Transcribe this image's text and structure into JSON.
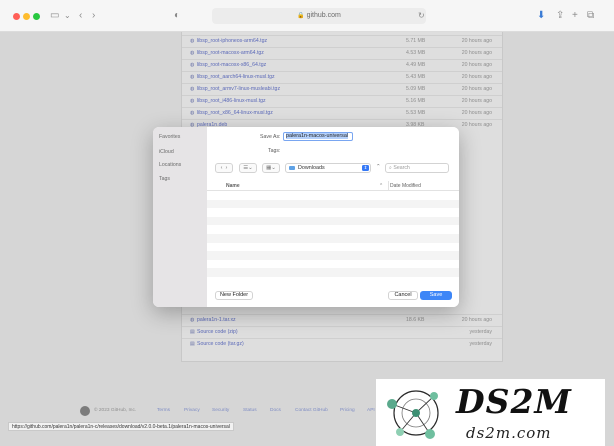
{
  "browser": {
    "url": "github.com",
    "lock_icon": "lock-icon"
  },
  "assets": [
    {
      "name": "libsp_root-iphoneos-arm64.tgz",
      "size": "5.71 MB",
      "date": "20 hours ago"
    },
    {
      "name": "libsp_root-macosx-arm64.tgz",
      "size": "4.53 MB",
      "date": "20 hours ago"
    },
    {
      "name": "libsp_root-macosx-x86_64.tgz",
      "size": "4.49 MB",
      "date": "20 hours ago"
    },
    {
      "name": "libsp_root_aarch64-linux-musl.tgz",
      "size": "5.43 MB",
      "date": "20 hours ago"
    },
    {
      "name": "libsp_root_armv7-linux-musleabi.tgz",
      "size": "5.09 MB",
      "date": "20 hours ago"
    },
    {
      "name": "libsp_root_i486-linux-musl.tgz",
      "size": "5.16 MB",
      "date": "20 hours ago"
    },
    {
      "name": "libsp_root_x86_64-linux-musl.tgz",
      "size": "5.53 MB",
      "date": "20 hours ago"
    },
    {
      "name": "palera1n.deb",
      "size": "3.98 KB",
      "date": "20 hours ago"
    }
  ],
  "assets_bottom": [
    {
      "name": "palera1n-1.tar.xz",
      "size": "18.6 KB",
      "date": "20 hours ago"
    },
    {
      "name": "Source code (zip)",
      "size": "",
      "date": "yesterday"
    },
    {
      "name": "Source code (tar.gz)",
      "size": "",
      "date": "yesterday"
    }
  ],
  "footer": {
    "copyright": "© 2023 GitHub, Inc.",
    "links": [
      "Terms",
      "Privacy",
      "Security",
      "Status",
      "Docs",
      "Contact GitHub",
      "Pricing",
      "API"
    ]
  },
  "status_url": "https://github.com/palera1n/palera1n-c/releases/download/v2.0.0-beta.1/palera1n-macos-universal",
  "dialog": {
    "save_as_label": "Save As:",
    "filename": "palera1n-macos-universal",
    "tags_label": "Tags:",
    "sidebar": [
      "Favorites",
      "iCloud",
      "Locations",
      "Tags"
    ],
    "location": "Downloads",
    "search_placeholder": "Search",
    "columns": {
      "name": "Name",
      "date_modified": "Date Modified"
    },
    "new_folder": "New Folder",
    "cancel": "Cancel",
    "save": "Save"
  },
  "watermark": {
    "title": "DS2M",
    "subtitle": "ds2m.com"
  }
}
